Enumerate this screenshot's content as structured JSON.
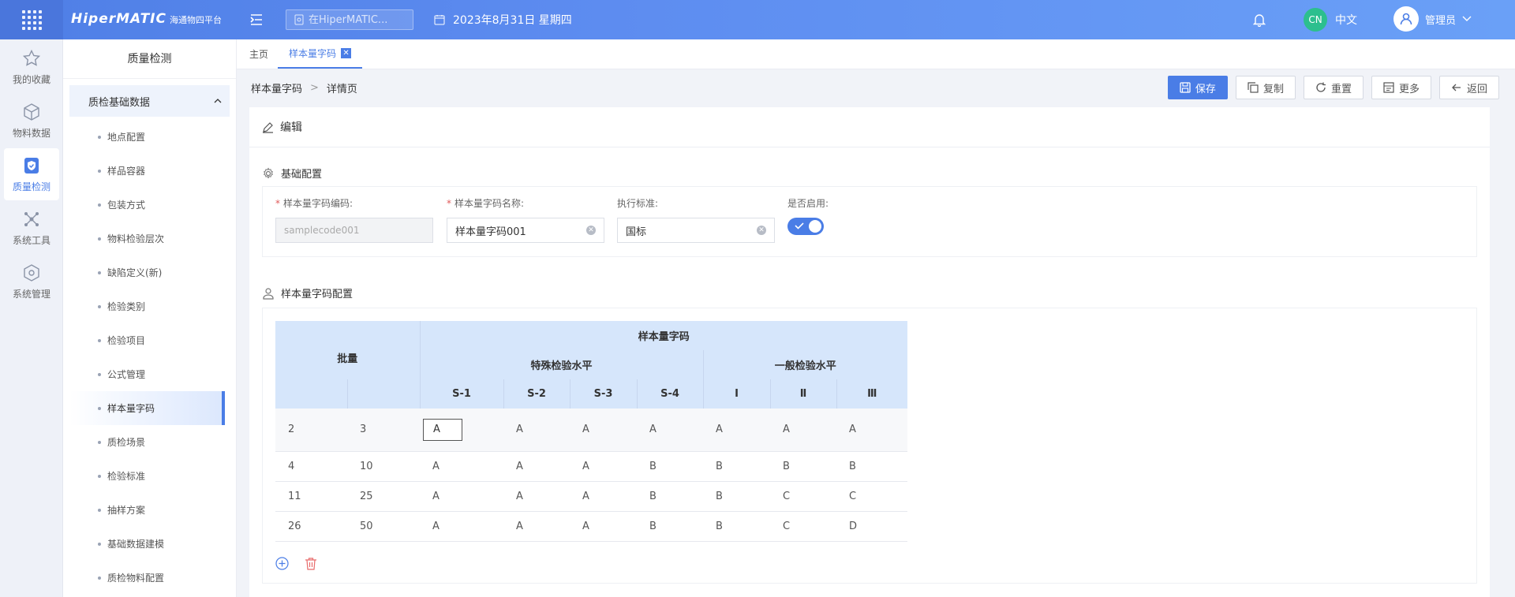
{
  "topbar": {
    "logo": "HiperMATIC",
    "logo_sub": "海通物四平台",
    "search_placeholder": "在HiperMATIC...",
    "date": "2023年8月31日 星期四",
    "lang_badge": "CN",
    "lang_label": "中文",
    "user": "管理员"
  },
  "rail": [
    {
      "label": "我的收藏",
      "icon": "star-icon"
    },
    {
      "label": "物料数据",
      "icon": "box-icon"
    },
    {
      "label": "质量检测",
      "icon": "quality-shield-icon"
    },
    {
      "label": "系统工具",
      "icon": "nodes-icon"
    },
    {
      "label": "系统管理",
      "icon": "cube-gear-icon"
    }
  ],
  "subnav": {
    "title": "质量检测",
    "group": "质检基础数据",
    "items": [
      "地点配置",
      "样品容器",
      "包装方式",
      "物料检验层次",
      "缺陷定义(新)",
      "检验类别",
      "检验项目",
      "公式管理",
      "样本量字码",
      "质检场景",
      "检验标准",
      "抽样方案",
      "基础数据建模",
      "质检物料配置"
    ]
  },
  "tabs": [
    {
      "label": "主页"
    },
    {
      "label": "样本量字码"
    }
  ],
  "breadcrumb": {
    "parent": "样本量字码",
    "sep": ">",
    "current": "详情页"
  },
  "actions": {
    "save": "保存",
    "copy": "复制",
    "reset": "重置",
    "more": "更多",
    "back": "返回"
  },
  "card": {
    "title": "编辑"
  },
  "base": {
    "title": "基础配置",
    "code_label": "样本量字码编码:",
    "code_value": "samplecode001",
    "name_label": "样本量字码名称:",
    "name_value": "样本量字码001",
    "standard_label": "执行标准:",
    "standard_value": "国标",
    "enabled_label": "是否启用:"
  },
  "config": {
    "title": "样本量字码配置",
    "header_group": "样本量字码",
    "batch": "批量",
    "special": "特殊检验水平",
    "general": "一般检验水平",
    "cols": [
      "S-1",
      "S-2",
      "S-3",
      "S-4",
      "Ⅰ",
      "Ⅱ",
      "Ⅲ"
    ],
    "rows": [
      [
        "2",
        "3",
        "A",
        "A",
        "A",
        "A",
        "A",
        "A",
        "A"
      ],
      [
        "4",
        "10",
        "A",
        "A",
        "A",
        "B",
        "B",
        "B",
        "B"
      ],
      [
        "11",
        "25",
        "A",
        "A",
        "A",
        "B",
        "B",
        "C",
        "C"
      ],
      [
        "26",
        "50",
        "A",
        "A",
        "A",
        "B",
        "B",
        "C",
        "D"
      ]
    ]
  }
}
